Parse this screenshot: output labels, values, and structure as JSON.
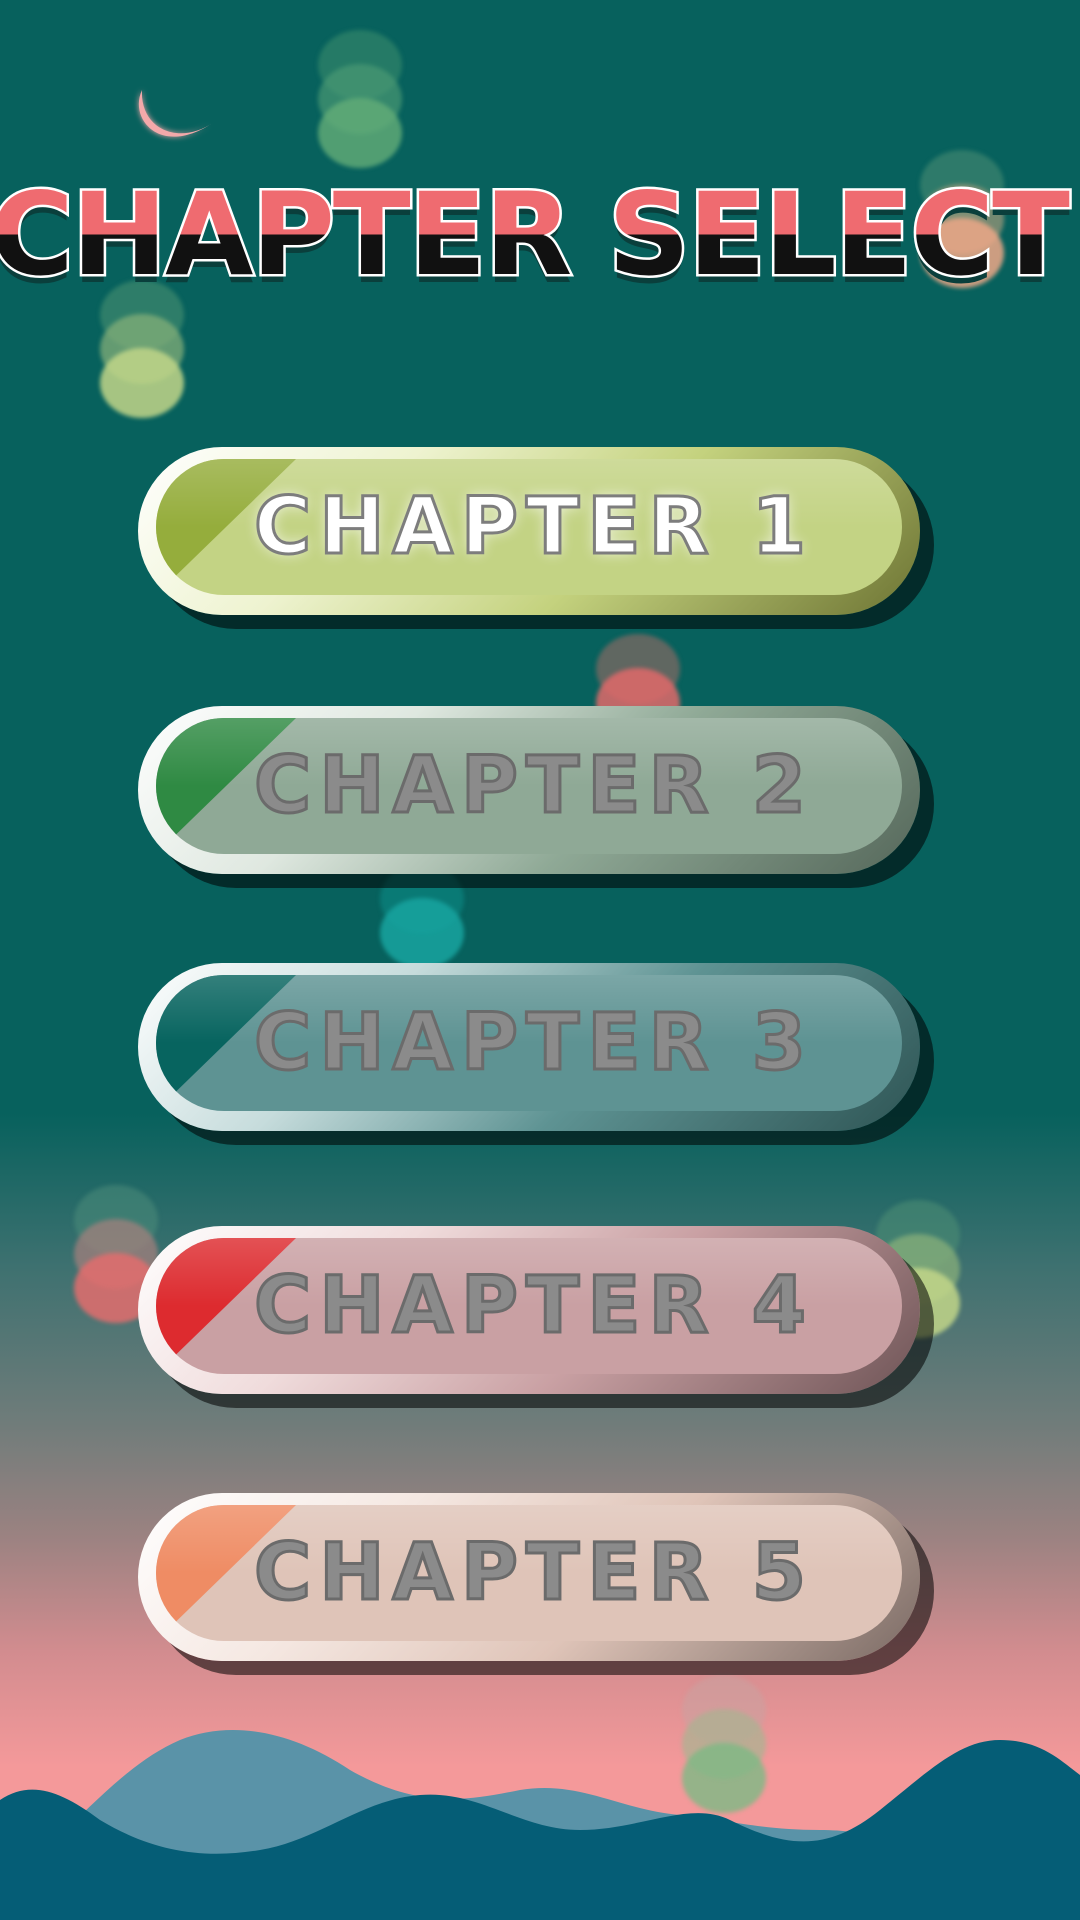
{
  "screen": {
    "title": "CHAPTER SELECT",
    "colors": {
      "title_fill": "#ef6b70",
      "title_dark": "#111111",
      "sky_top": "#07615d",
      "sky_bottom": "#f4999a",
      "mountain_back": "#5a93a8",
      "mountain_front": "#055d76"
    }
  },
  "chapters": [
    {
      "label": "CHAPTER 1",
      "state": "unlocked",
      "face_color": "#c3d384",
      "accent_color": "#95ad3c"
    },
    {
      "label": "CHAPTER 2",
      "state": "locked",
      "face_color": "#8fa996",
      "accent_color": "#2f8a43"
    },
    {
      "label": "CHAPTER 3",
      "state": "locked",
      "face_color": "#5e9393",
      "accent_color": "#07645f"
    },
    {
      "label": "CHAPTER 4",
      "state": "locked",
      "face_color": "#c9a0a3",
      "accent_color": "#dd2b2f"
    },
    {
      "label": "CHAPTER 5",
      "state": "locked",
      "face_color": "#dfc4b8",
      "accent_color": "#ef8c64"
    }
  ],
  "decorations": {
    "icons": [
      "crescent-moon-icon",
      "coin-stack-icon",
      "mountain-range"
    ]
  }
}
